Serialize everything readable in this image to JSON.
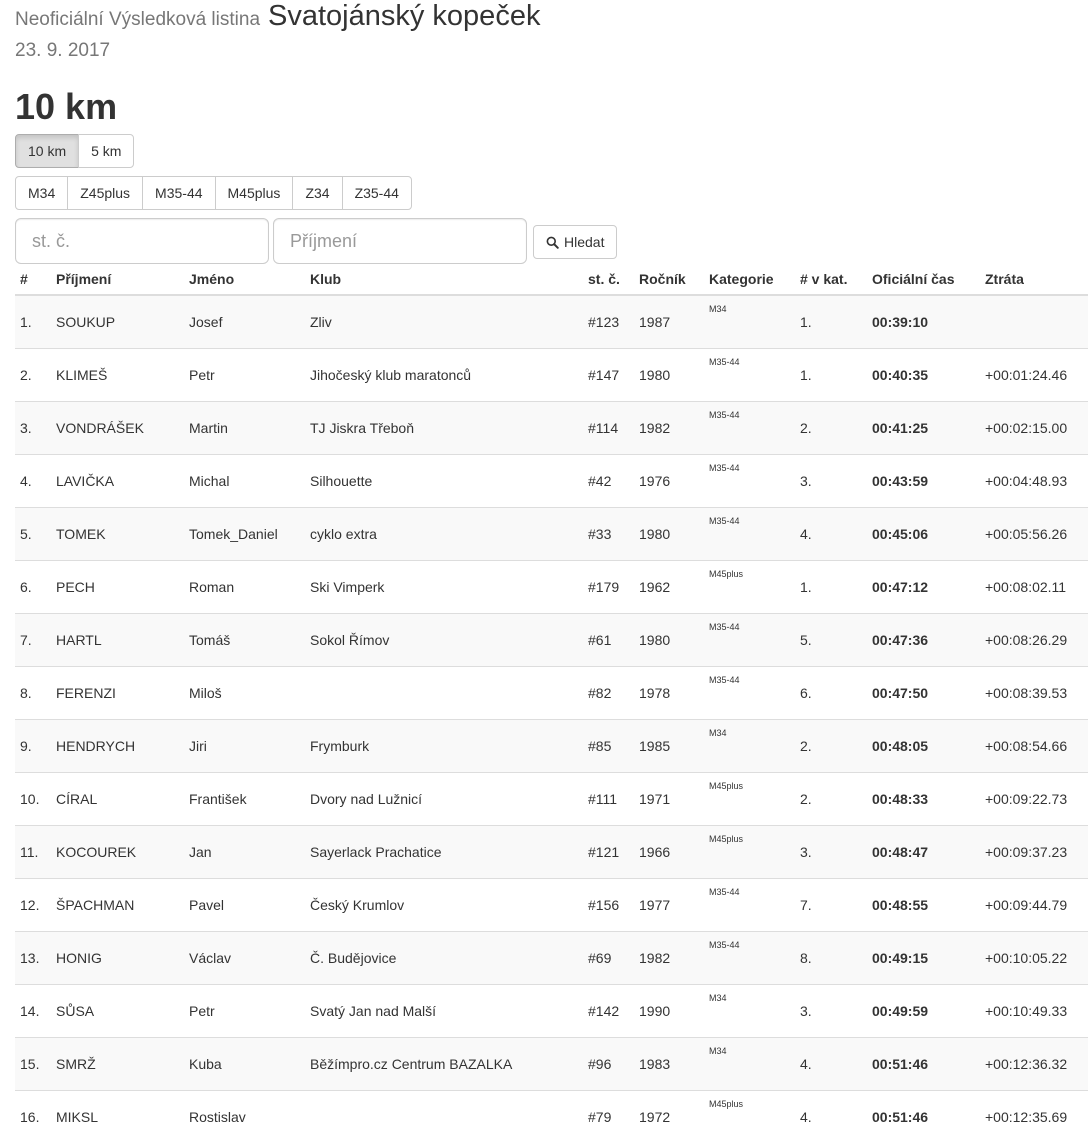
{
  "header": {
    "subtitle": "Neoficiální Výsledková listina",
    "event_title": "Svatojánský kopeček",
    "date": "23. 9. 2017"
  },
  "race": {
    "title": "10 km"
  },
  "distances": [
    {
      "label": "10 km",
      "active": true
    },
    {
      "label": "5 km",
      "active": false
    }
  ],
  "categories": [
    "M34",
    "Z45plus",
    "M35-44",
    "M45plus",
    "Z34",
    "Z35-44"
  ],
  "search": {
    "bib_placeholder": "st. č.",
    "surname_placeholder": "Příjmení",
    "button_label": "Hledat"
  },
  "table": {
    "headers": [
      "#",
      "Příjmení",
      "Jméno",
      "Klub",
      "st. č.",
      "Ročník",
      "Kategorie",
      "# v kat.",
      "Oficiální čas",
      "Ztráta"
    ],
    "rows": [
      [
        "1.",
        "SOUKUP",
        "Josef",
        "Zliv",
        "#123",
        "1987",
        "M34",
        "1.",
        "00:39:10",
        ""
      ],
      [
        "2.",
        "KLIMEŠ",
        "Petr",
        "Jihočeský klub maratonců",
        "#147",
        "1980",
        "M35-44",
        "1.",
        "00:40:35",
        "+00:01:24.46"
      ],
      [
        "3.",
        "VONDRÁŠEK",
        "Martin",
        "TJ Jiskra Třeboň",
        "#114",
        "1982",
        "M35-44",
        "2.",
        "00:41:25",
        "+00:02:15.00"
      ],
      [
        "4.",
        "LAVIČKA",
        "Michal",
        "Silhouette",
        "#42",
        "1976",
        "M35-44",
        "3.",
        "00:43:59",
        "+00:04:48.93"
      ],
      [
        "5.",
        "TOMEK",
        "Tomek_Daniel",
        "cyklo extra",
        "#33",
        "1980",
        "M35-44",
        "4.",
        "00:45:06",
        "+00:05:56.26"
      ],
      [
        "6.",
        "PECH",
        "Roman",
        "Ski Vimperk",
        "#179",
        "1962",
        "M45plus",
        "1.",
        "00:47:12",
        "+00:08:02.11"
      ],
      [
        "7.",
        "HARTL",
        "Tomáš",
        "Sokol Římov",
        "#61",
        "1980",
        "M35-44",
        "5.",
        "00:47:36",
        "+00:08:26.29"
      ],
      [
        "8.",
        "FERENZI",
        "Miloš",
        "",
        "#82",
        "1978",
        "M35-44",
        "6.",
        "00:47:50",
        "+00:08:39.53"
      ],
      [
        "9.",
        "HENDRYCH",
        "Jiri",
        "Frymburk",
        "#85",
        "1985",
        "M34",
        "2.",
        "00:48:05",
        "+00:08:54.66"
      ],
      [
        "10.",
        "CÍRAL",
        "František",
        "Dvory nad Lužnicí",
        "#111",
        "1971",
        "M45plus",
        "2.",
        "00:48:33",
        "+00:09:22.73"
      ],
      [
        "11.",
        "KOCOUREK",
        "Jan",
        "Sayerlack Prachatice",
        "#121",
        "1966",
        "M45plus",
        "3.",
        "00:48:47",
        "+00:09:37.23"
      ],
      [
        "12.",
        "ŠPACHMAN",
        "Pavel",
        "Český Krumlov",
        "#156",
        "1977",
        "M35-44",
        "7.",
        "00:48:55",
        "+00:09:44.79"
      ],
      [
        "13.",
        "HONIG",
        "Václav",
        "Č. Budějovice",
        "#69",
        "1982",
        "M35-44",
        "8.",
        "00:49:15",
        "+00:10:05.22"
      ],
      [
        "14.",
        "SŮSA",
        "Petr",
        "Svatý Jan nad Malší",
        "#142",
        "1990",
        "M34",
        "3.",
        "00:49:59",
        "+00:10:49.33"
      ],
      [
        "15.",
        "SMRŽ",
        "Kuba",
        "Běžímpro.cz Centrum BAZALKA",
        "#96",
        "1983",
        "M34",
        "4.",
        "00:51:46",
        "+00:12:36.32"
      ],
      [
        "16.",
        "MIKSL",
        "Rostislav",
        "",
        "#79",
        "1972",
        "M45plus",
        "4.",
        "00:51:46",
        "+00:12:35.69"
      ]
    ]
  }
}
